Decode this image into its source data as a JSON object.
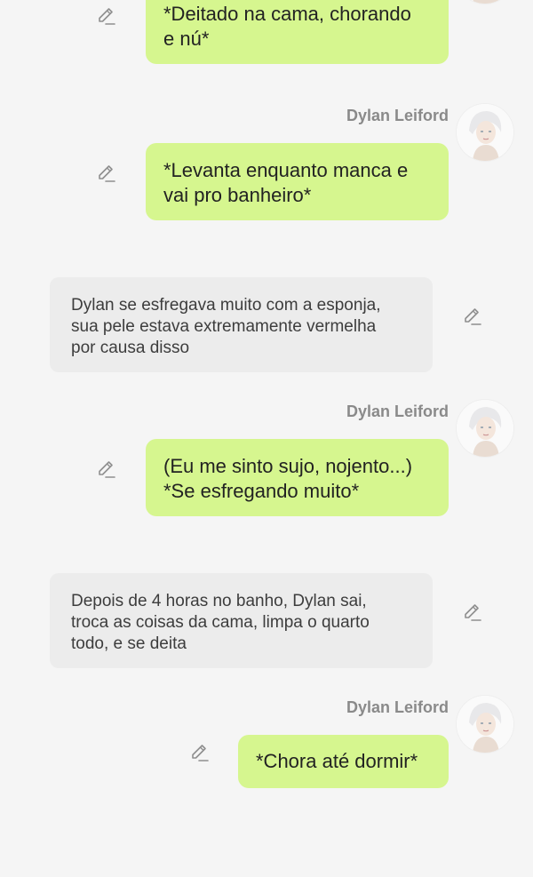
{
  "icons": {
    "edit": "pencil-edit-icon",
    "avatar": "avatar-portrait"
  },
  "colors": {
    "background": "#f5f5f5",
    "user_bubble": "#d6f68f",
    "narration_bubble": "#ececec",
    "sender_name": "#8a8a8a"
  },
  "messages": [
    {
      "role": "user",
      "text": "*Deitado na cama, chorando\ne nú*"
    },
    {
      "role": "character",
      "sender": "Dylan Leiford",
      "text": "*Levanta enquanto manca e\nvai pro banheiro*"
    },
    {
      "role": "narration",
      "text": "Dylan se esfregava muito com a esponja,\nsua pele estava extremamente vermelha\npor causa disso"
    },
    {
      "role": "character",
      "sender": "Dylan Leiford",
      "text": "(Eu me sinto sujo, nojento...)\n*Se esfregando muito*"
    },
    {
      "role": "narration",
      "text": "Depois de 4 horas no banho, Dylan sai,\ntroca as coisas da cama, limpa o quarto\ntodo, e se deita"
    },
    {
      "role": "character",
      "sender": "Dylan Leiford",
      "text": "*Chora até dormir*"
    }
  ]
}
